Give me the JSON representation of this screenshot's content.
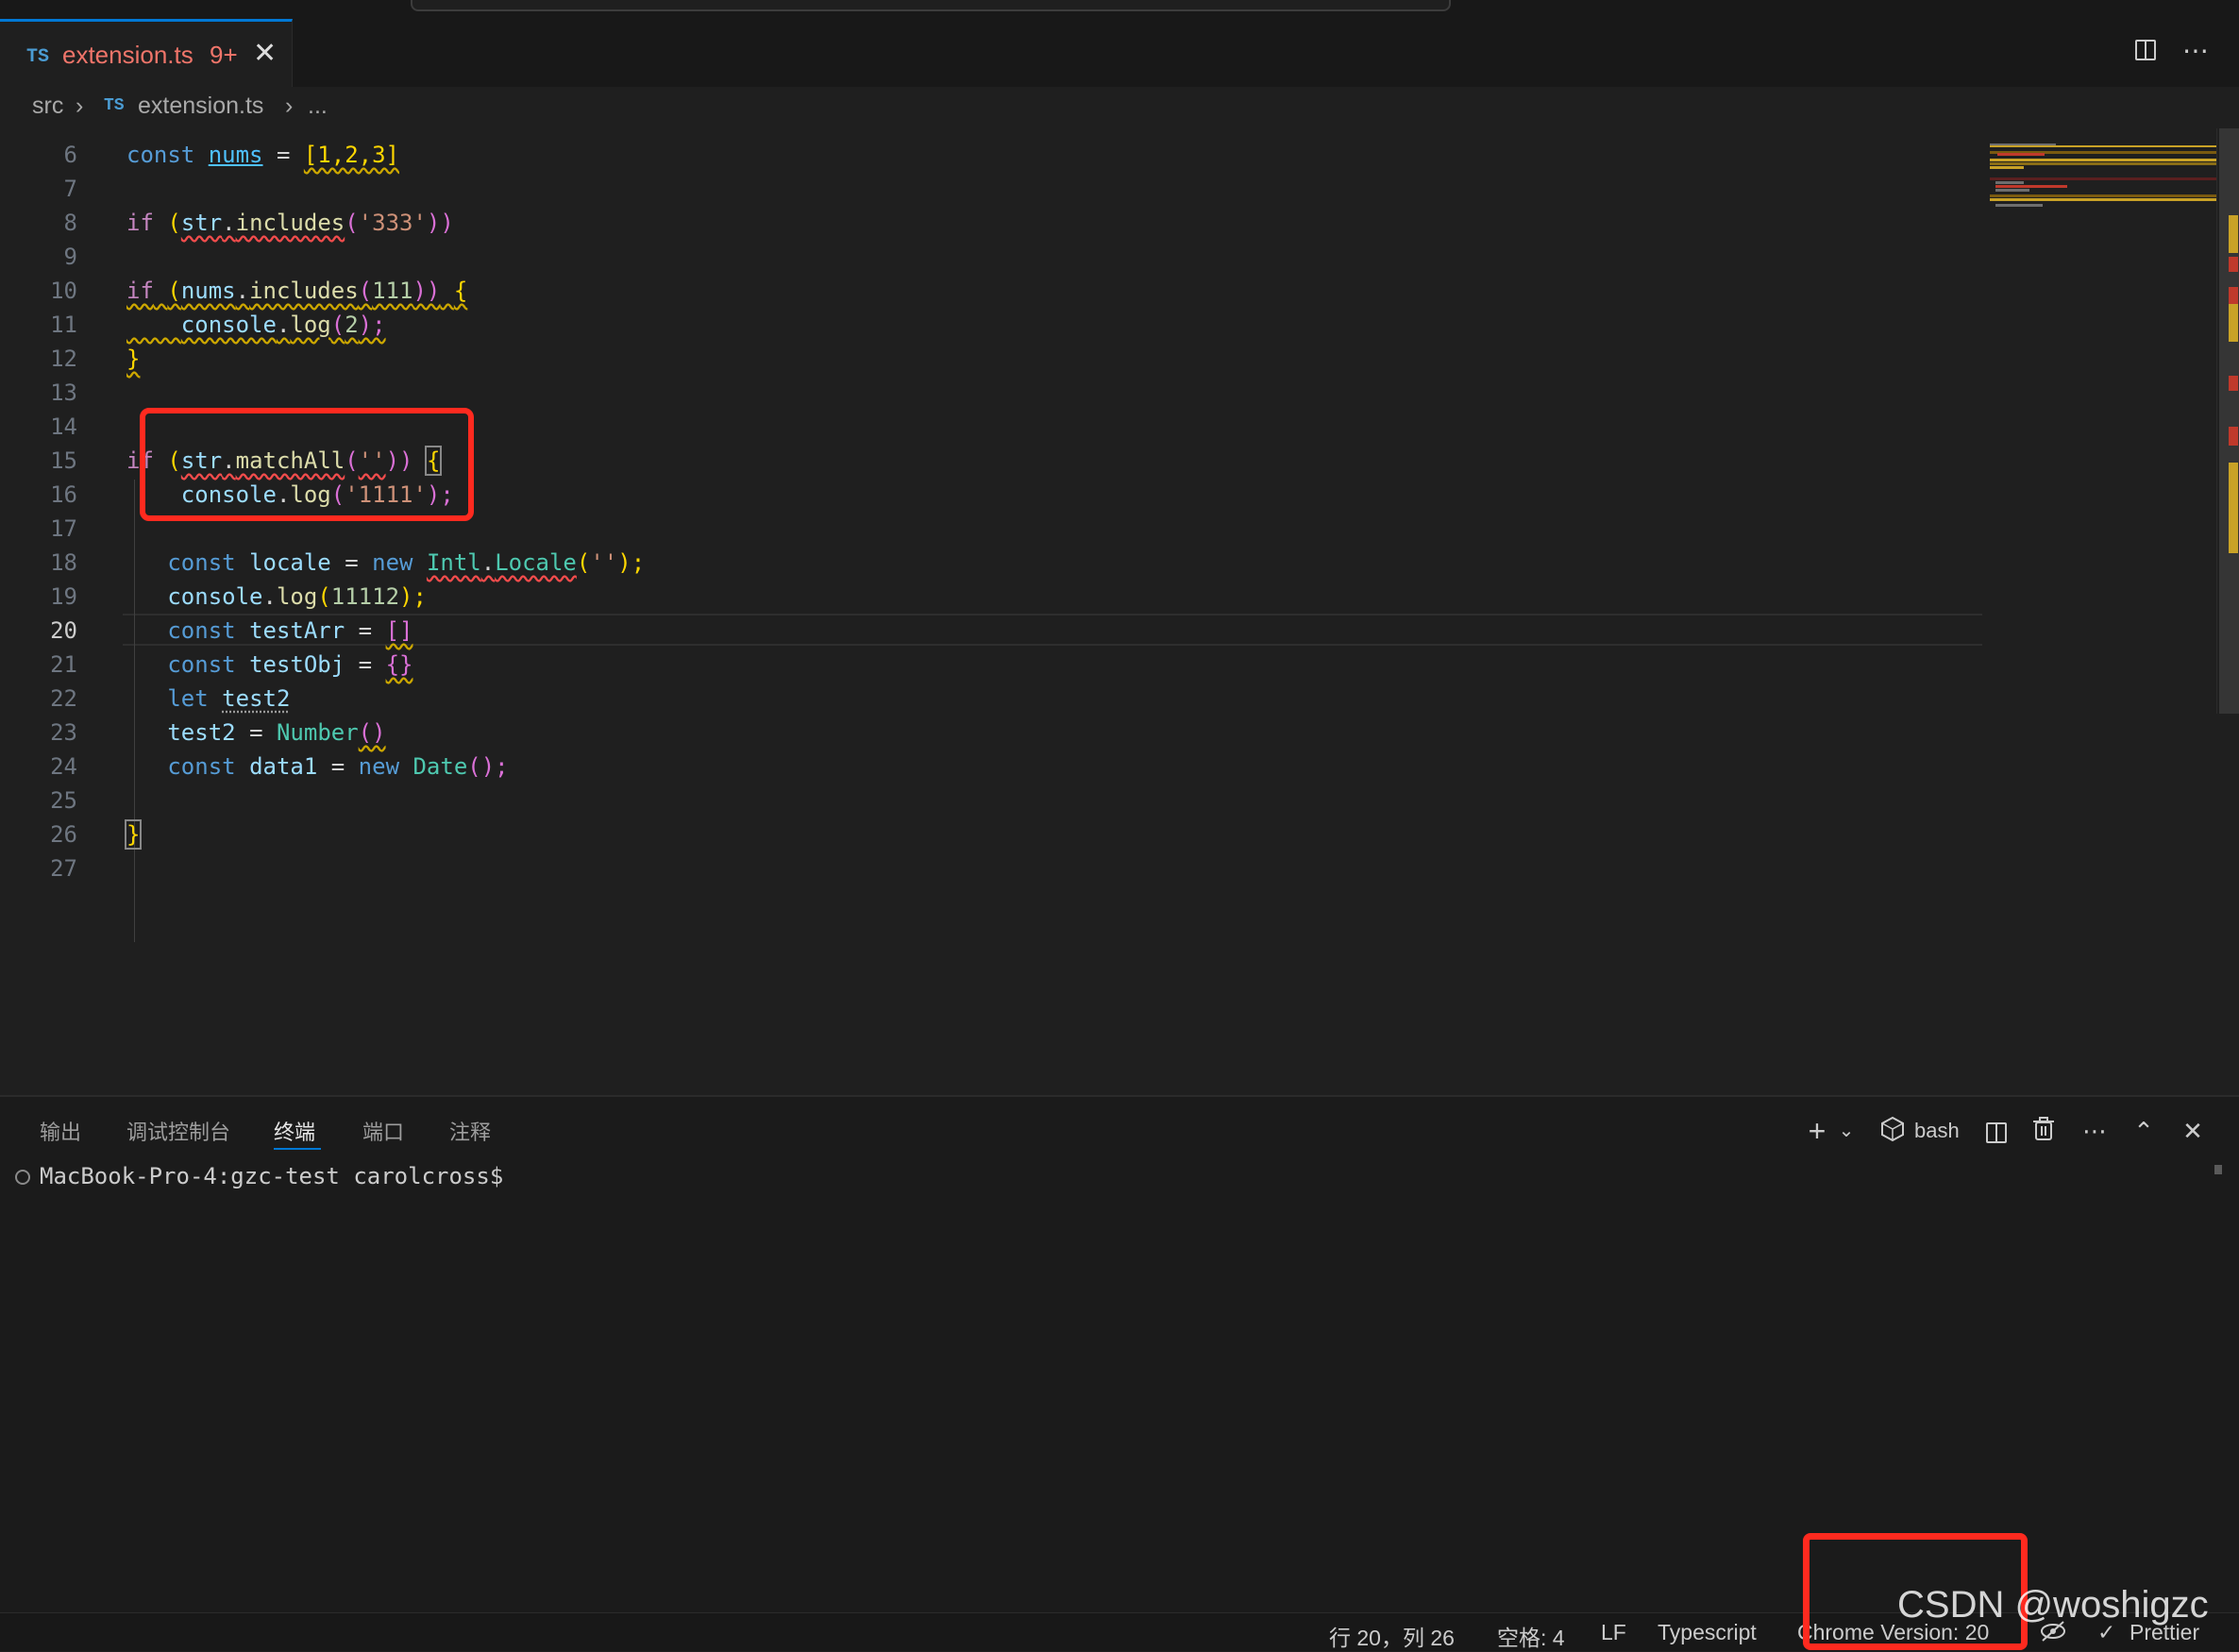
{
  "tab": {
    "badge": "TS",
    "filename": "extension.ts",
    "problems": "9+",
    "close": "✕"
  },
  "toolbar": {
    "more": "⋯"
  },
  "breadcrumb": {
    "folder": "src",
    "sep": "›",
    "badge": "TS",
    "file": "extension.ts",
    "sep2": "›",
    "ellipsis": "..."
  },
  "editor": {
    "current_line": "20",
    "line_numbers": [
      "6",
      "7",
      "8",
      "9",
      "10",
      "11",
      "12",
      "13",
      "14",
      "15",
      "16",
      "17",
      "18",
      "19",
      "20",
      "21",
      "22",
      "23",
      "24",
      "25",
      "26",
      "27"
    ],
    "code": {
      "l6": [
        "const",
        "nums",
        "=",
        "[1,2,3]"
      ],
      "l8": [
        "if",
        "(",
        "str",
        ".",
        "includes",
        "(",
        "'333'",
        "))"
      ],
      "l10": [
        "if",
        "(",
        "nums",
        ".",
        "includes",
        "(",
        "111",
        "))",
        "{"
      ],
      "l11": [
        "console",
        ".",
        "log",
        "(",
        "2",
        ");"
      ],
      "l12": [
        "}"
      ],
      "l15": [
        "if",
        "(",
        "str",
        ".",
        "matchAll",
        "(",
        "''",
        "))",
        "{"
      ],
      "l16": [
        "console",
        ".",
        "log",
        "(",
        "'1111'",
        ");"
      ],
      "l18": [
        "const",
        "locale",
        "=",
        "new",
        "Intl",
        ".",
        "Locale",
        "(",
        "''",
        ");"
      ],
      "l19": [
        "console",
        ".",
        "log",
        "(",
        "11112",
        ");"
      ],
      "l20": [
        "const",
        "testArr",
        "=",
        "[]"
      ],
      "l21": [
        "const",
        "testObj",
        "=",
        "{}"
      ],
      "l22": [
        "let",
        "test2"
      ],
      "l23": [
        "test2",
        "=",
        "Number",
        "()"
      ],
      "l24": [
        "const",
        "data1",
        "=",
        "new",
        "Date",
        "();"
      ],
      "l26": [
        "}"
      ]
    }
  },
  "panel": {
    "tabs": [
      "输出",
      "调试控制台",
      "终端",
      "端口",
      "注释"
    ],
    "active_tab": "终端",
    "terminal_name": "bash",
    "prompt": "MacBook-Pro-4:gzc-test carolcross$",
    "icons": {
      "plus": "+",
      "chevron": "⌄",
      "more": "⋯",
      "up": "⌃",
      "close": "✕"
    }
  },
  "statusbar": {
    "position": "行 20，列 26",
    "spaces": "空格: 4",
    "eol": "LF",
    "language": "Typescript",
    "chrome": "Chrome Version: 20",
    "prettier": "Prettier"
  },
  "watermark": "CSDN @woshigzc",
  "colors": {
    "highlight_box": "#ff2a1f",
    "accent": "#0078d4"
  }
}
